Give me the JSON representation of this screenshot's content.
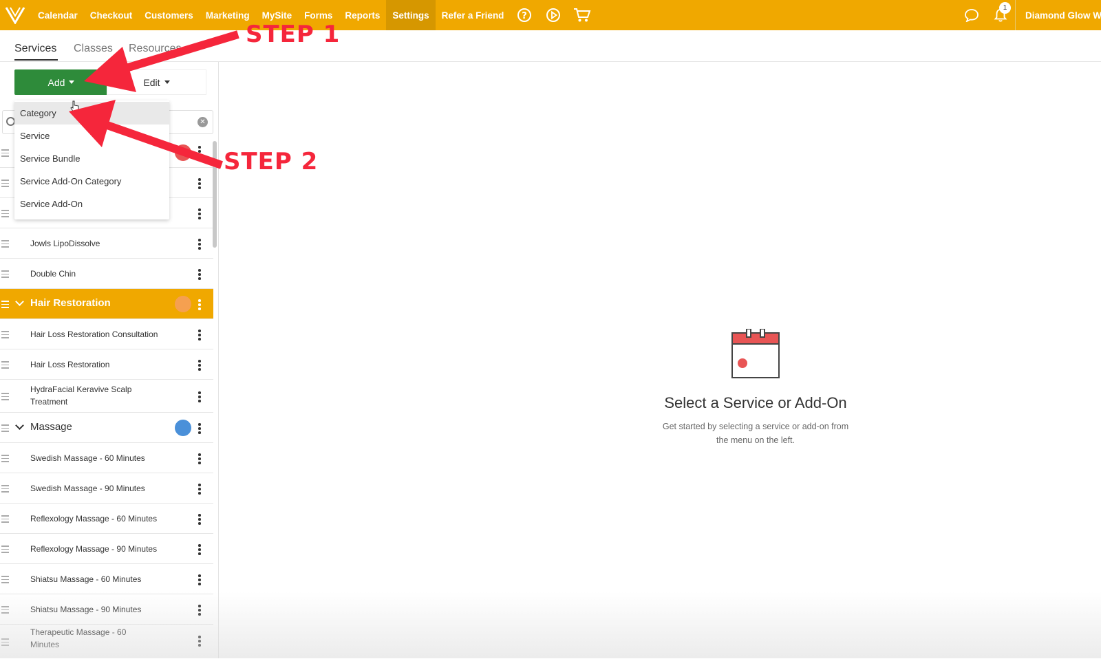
{
  "topnav": {
    "items": [
      "Calendar",
      "Checkout",
      "Customers",
      "Marketing",
      "MySite",
      "Forms",
      "Reports",
      "Settings",
      "Refer a Friend"
    ],
    "active": "Settings",
    "account": "Diamond Glow We",
    "notification_count": "1"
  },
  "subtabs": [
    "Services",
    "Classes",
    "Resources"
  ],
  "toolbar": {
    "add_label": "Add",
    "edit_label": "Edit"
  },
  "dropdown": [
    "Category",
    "Service",
    "Service Bundle",
    "Service Add-On Category",
    "Service Add-On"
  ],
  "list": {
    "rows": [
      {
        "label": "Jowls LipoDissolve"
      },
      {
        "label": "Double Chin"
      },
      {
        "label": "Hair Restoration",
        "category": true
      },
      {
        "label": "Hair Loss Restoration Consultation"
      },
      {
        "label": "Hair Loss Restoration"
      },
      {
        "label": "HydraFacial Keravive Scalp",
        "label2": "Treatment"
      },
      {
        "label": "Massage",
        "category": true
      },
      {
        "label": "Swedish Massage - 60 Minutes"
      },
      {
        "label": "Swedish Massage - 90 Minutes"
      },
      {
        "label": "Reflexology Massage - 60 Minutes"
      },
      {
        "label": "Reflexology Massage - 90 Minutes"
      },
      {
        "label": "Shiatsu Massage - 60 Minutes"
      },
      {
        "label": "Shiatsu Massage - 90 Minutes"
      },
      {
        "label": "Therapeutic Massage - 60",
        "label2": "Minutes"
      }
    ]
  },
  "colors": {
    "brand": "#f0a800",
    "add_button": "#2e8b3a",
    "annotation": "#f5263b",
    "dot_hidden_category": "#e85555",
    "dot_hair": "#f5a050",
    "dot_massage": "#4a90d9"
  },
  "empty_state": {
    "title": "Select a Service or Add-On",
    "subtitle_line1": "Get started by selecting a service or add-on from",
    "subtitle_line2": "the menu on the left."
  },
  "annotations": {
    "step1": "STEP 1",
    "step2": "STEP 2"
  }
}
